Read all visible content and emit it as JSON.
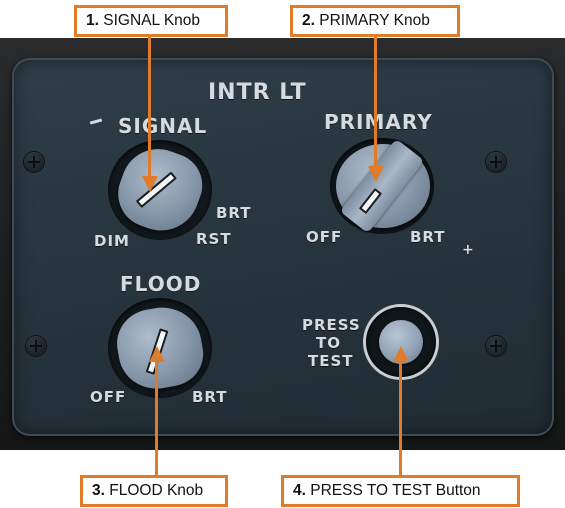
{
  "panel": {
    "title": "INTR LT",
    "signal": {
      "label": "SIGNAL",
      "dim": "DIM",
      "brt": "BRT",
      "rst": "RST"
    },
    "primary": {
      "label": "PRIMARY",
      "off": "OFF",
      "brt": "BRT"
    },
    "flood": {
      "label": "FLOOD",
      "off": "OFF",
      "brt": "BRT"
    },
    "test": {
      "line1": "PRESS",
      "line2": "TO",
      "line3": "TEST"
    }
  },
  "callouts": [
    {
      "number": "1.",
      "text": "SIGNAL Knob"
    },
    {
      "number": "2.",
      "text": "PRIMARY Knob"
    },
    {
      "number": "3.",
      "text": "FLOOD Knob"
    },
    {
      "number": "4.",
      "text": "PRESS TO TEST Button"
    }
  ],
  "colors": {
    "callout_accent": "#e07b2a",
    "panel": "#2b3942",
    "engraving": "#d6dbdf",
    "knob": "#8e9fb1"
  }
}
